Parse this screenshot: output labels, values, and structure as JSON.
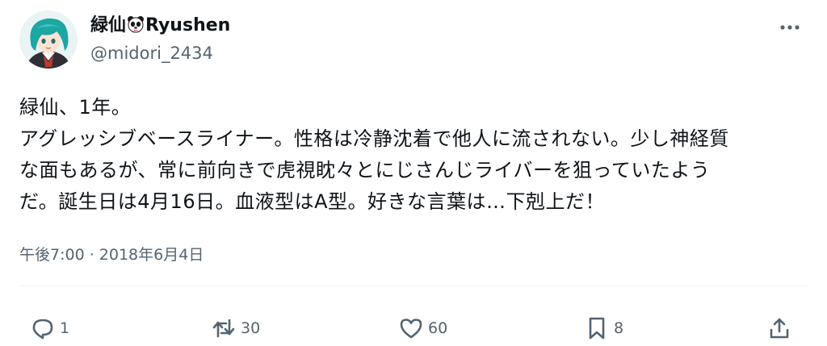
{
  "user": {
    "name_prefix": "緑仙",
    "name_suffix": "Ryushen",
    "handle": "@midori_2434"
  },
  "icons": {
    "name_emoji": "panda-face-icon",
    "more": "more-horizontal-icon",
    "reply": "reply-icon",
    "retweet": "retweet-icon",
    "like": "heart-icon",
    "bookmark": "bookmark-icon",
    "share": "share-icon"
  },
  "tweet": {
    "lines": [
      "緑仙、1年。",
      "アグレッシブベースライナー。性格は冷静沈着で他人に流されない。少し神経質",
      "な面もあるが、常に前向きで虎視眈々とにじさんじライバーを狙っていたよう",
      "だ。誕生日は4月16日。血液型はA型。好きな言葉は…下剋上だ！"
    ],
    "timestamp": "午後7:00 · 2018年6月4日"
  },
  "actions": {
    "reply_count": "1",
    "retweet_count": "30",
    "like_count": "60",
    "bookmark_count": "8"
  },
  "colors": {
    "text": "#0f1419",
    "secondary": "#536471",
    "avatar_hair": "#1ea6a3"
  }
}
